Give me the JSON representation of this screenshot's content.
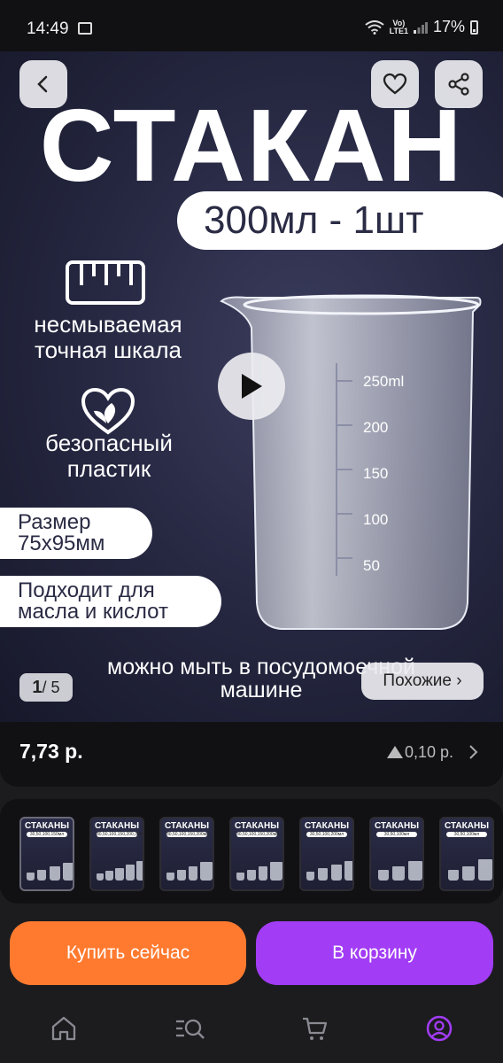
{
  "status_bar": {
    "time": "14:49",
    "network": "Vo)\nLTE1",
    "battery": "17%"
  },
  "hero": {
    "title": "СТАКАН",
    "volume": "300мл - 1шт",
    "features": [
      {
        "text": "несмываемая\nточная шкала",
        "icon": "ruler-icon"
      },
      {
        "text": "безопасный\nпластик",
        "icon": "heart-leaf-icon"
      }
    ],
    "size_label": "Размер\n75х95мм",
    "oil_label": "Подходит для\nмасла и кислот",
    "wash_label": "можно мыть в посудомоечной\nмашине",
    "beaker_marks": [
      "250ml",
      "200",
      "150",
      "100",
      "50"
    ],
    "counter_current": "1",
    "counter_total": "/ 5",
    "similar_label": "Похожие ›"
  },
  "price": {
    "value": "7,73 р.",
    "change": "0,10 р."
  },
  "thumbnails": [
    {
      "title": "СТАКАНЫ",
      "sizes": "30,50,100,150мл"
    },
    {
      "title": "СТАКАНЫ",
      "sizes": "30,50,100,150,200,300мл"
    },
    {
      "title": "СТАКАНЫ",
      "sizes": "30,50,100,150,200мл"
    },
    {
      "title": "СТАКАНЫ",
      "sizes": "30,50,100,150,200мл"
    },
    {
      "title": "СТАКАНЫ",
      "sizes": "30,50,100,200мл"
    },
    {
      "title": "СТАКАНЫ",
      "sizes": "30,50,100мл"
    },
    {
      "title": "СТАКАНЫ",
      "sizes": "30,50,100мл"
    }
  ],
  "actions": {
    "buy_now": "Купить сейчас",
    "add_to_cart": "В корзину"
  },
  "nav": [
    "home-icon",
    "catalog-search-icon",
    "cart-icon",
    "profile-icon"
  ],
  "colors": {
    "buy": "#ff7a2f",
    "cart": "#a23cf5",
    "background": "#1c1c1f"
  }
}
